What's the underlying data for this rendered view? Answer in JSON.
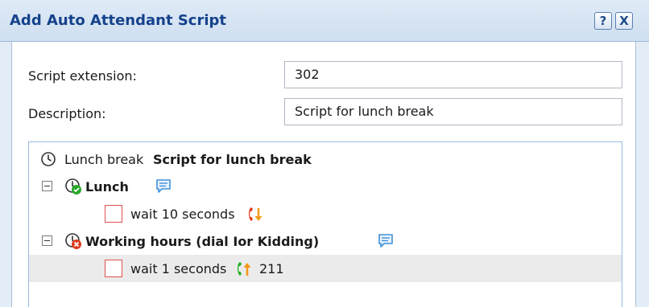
{
  "dialog": {
    "title": "Add Auto Attendant Script",
    "help_button": "?",
    "close_button": "X"
  },
  "form": {
    "extension_label": "Script extension:",
    "extension_value": "302",
    "description_label": "Description:",
    "description_value": "Script for lunch break"
  },
  "tree": {
    "root": {
      "name": "Lunch break",
      "description": "Script for lunch break",
      "icon": "clock-icon"
    },
    "nodes": [
      {
        "label": "Lunch",
        "icon": "clock-active-icon",
        "comment_icon": "comment-bubble-icon",
        "actions": [
          {
            "text": "wait 10 seconds",
            "icon": "hangup-red-icon",
            "target": ""
          }
        ]
      },
      {
        "label": "Working hours (dial Ior Kidding)",
        "icon": "clock-inactive-icon",
        "comment_icon": "comment-bubble-icon",
        "actions": [
          {
            "text": "wait 1 seconds",
            "icon": "call-green-icon",
            "target": "211"
          }
        ]
      }
    ]
  },
  "colors": {
    "title_text": "#15428b",
    "active_green": "#28a828",
    "inactive_red": "#e03a1e",
    "call_green": "#1fae1f",
    "hangup_red": "#e23b1c",
    "hangup_orange": "#f29a1a",
    "comment_blue": "#3d8fd8"
  }
}
